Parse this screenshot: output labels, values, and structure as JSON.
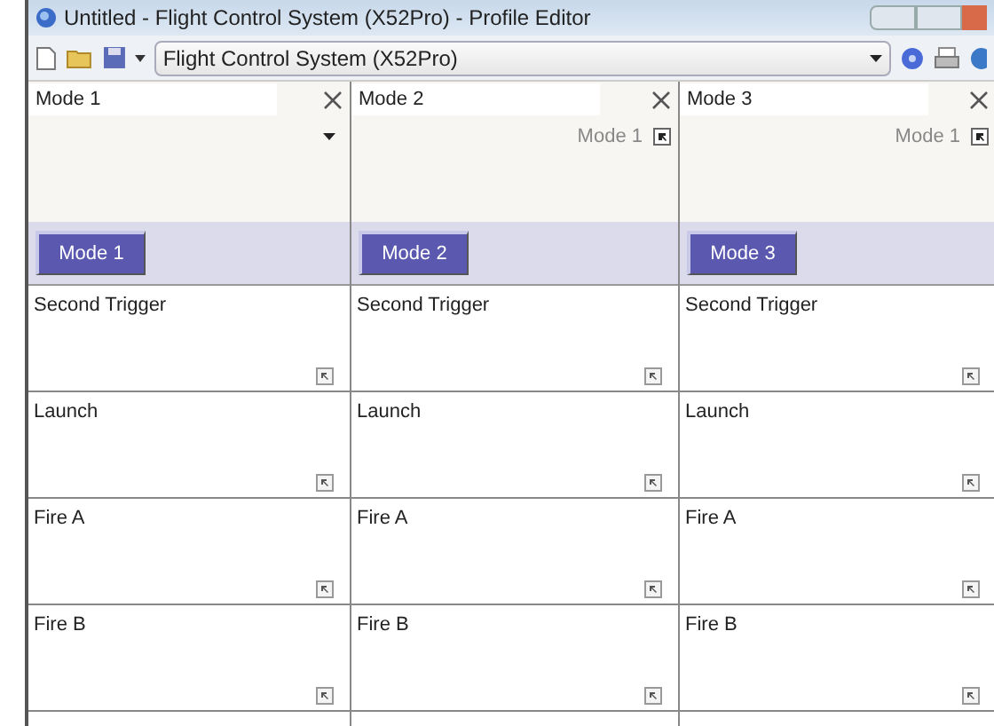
{
  "window": {
    "title": "Untitled - Flight Control System (X52Pro) - Profile Editor"
  },
  "toolbar": {
    "profile": "Flight Control System (X52Pro)"
  },
  "modes": [
    {
      "name": "Mode 1",
      "kind": "dropdown",
      "button": "Mode 1",
      "cells": [
        "Second Trigger",
        "Launch",
        "Fire A",
        "Fire B"
      ]
    },
    {
      "name": "Mode 2",
      "kind": "link",
      "linked": "Mode 1",
      "button": "Mode 2",
      "cells": [
        "Second Trigger",
        "Launch",
        "Fire A",
        "Fire B"
      ]
    },
    {
      "name": "Mode 3",
      "kind": "link",
      "linked": "Mode 1",
      "button": "Mode 3",
      "cells": [
        "Second Trigger",
        "Launch",
        "Fire A",
        "Fire B"
      ]
    }
  ]
}
